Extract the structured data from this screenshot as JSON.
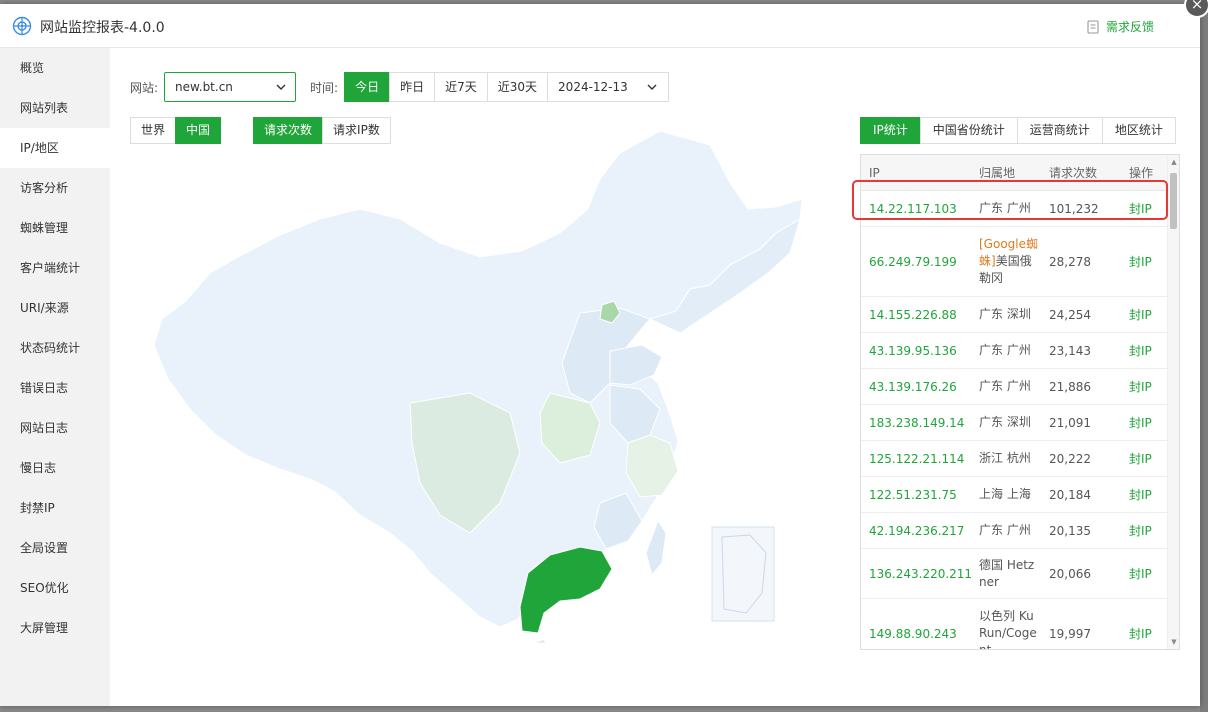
{
  "app": {
    "title": "网站监控报表-4.0.0",
    "feedback": "需求反馈",
    "close": "×"
  },
  "sidebar": {
    "items": [
      {
        "label": "概览"
      },
      {
        "label": "网站列表"
      },
      {
        "label": "IP/地区",
        "active": true
      },
      {
        "label": "访客分析"
      },
      {
        "label": "蜘蛛管理"
      },
      {
        "label": "客户端统计"
      },
      {
        "label": "URI/来源"
      },
      {
        "label": "状态码统计"
      },
      {
        "label": "错误日志"
      },
      {
        "label": "网站日志"
      },
      {
        "label": "慢日志"
      },
      {
        "label": "封禁IP"
      },
      {
        "label": "全局设置"
      },
      {
        "label": "SEO优化"
      },
      {
        "label": "大屏管理"
      }
    ]
  },
  "filters": {
    "site_label": "网站:",
    "site_value": "new.bt.cn",
    "time_label": "时间:",
    "time_options": [
      "今日",
      "昨日",
      "近7天",
      "近30天"
    ],
    "time_selected": "今日",
    "date_value": "2024-12-13"
  },
  "map_toggle": {
    "options": [
      "世界",
      "中国"
    ],
    "selected": "中国"
  },
  "metric_toggle": {
    "options": [
      "请求次数",
      "请求IP数"
    ],
    "selected": "请求次数"
  },
  "stat_tabs": {
    "options": [
      "IP统计",
      "中国省份统计",
      "运营商统计",
      "地区统计"
    ],
    "selected": "IP统计"
  },
  "table": {
    "headers": {
      "ip": "IP",
      "location": "归属地",
      "count": "请求次数",
      "op": "操作"
    },
    "ban_label": "封IP",
    "rows": [
      {
        "ip": "14.22.117.103",
        "location": "广东 广州",
        "count": "101,232"
      },
      {
        "ip": "66.249.79.199",
        "spider": "[Google蜘蛛]",
        "location": "美国俄勒冈",
        "count": "28,278"
      },
      {
        "ip": "14.155.226.88",
        "location": "广东 深圳",
        "count": "24,254"
      },
      {
        "ip": "43.139.95.136",
        "location": "广东 广州",
        "count": "23,143"
      },
      {
        "ip": "43.139.176.26",
        "location": "广东 广州",
        "count": "21,886"
      },
      {
        "ip": "183.238.149.14",
        "location": "广东 深圳",
        "count": "21,091"
      },
      {
        "ip": "125.122.21.114",
        "location": "浙江 杭州",
        "count": "20,222"
      },
      {
        "ip": "122.51.231.75",
        "location": "上海 上海",
        "count": "20,184"
      },
      {
        "ip": "42.194.236.217",
        "location": "广东 广州",
        "count": "20,135"
      },
      {
        "ip": "136.243.220.211",
        "location": "德国 Hetzner",
        "count": "20,066"
      },
      {
        "ip": "149.88.90.243",
        "location": "以色列 KuRun/Cogent",
        "count": "19,997"
      }
    ]
  },
  "colors": {
    "accent": "#20a53a",
    "map_base": "#e9f1fa",
    "map_light": "#dde9f4",
    "map_mid": "#dcefdc",
    "map_strong": "#20a53a",
    "highlight": "#e53935"
  }
}
